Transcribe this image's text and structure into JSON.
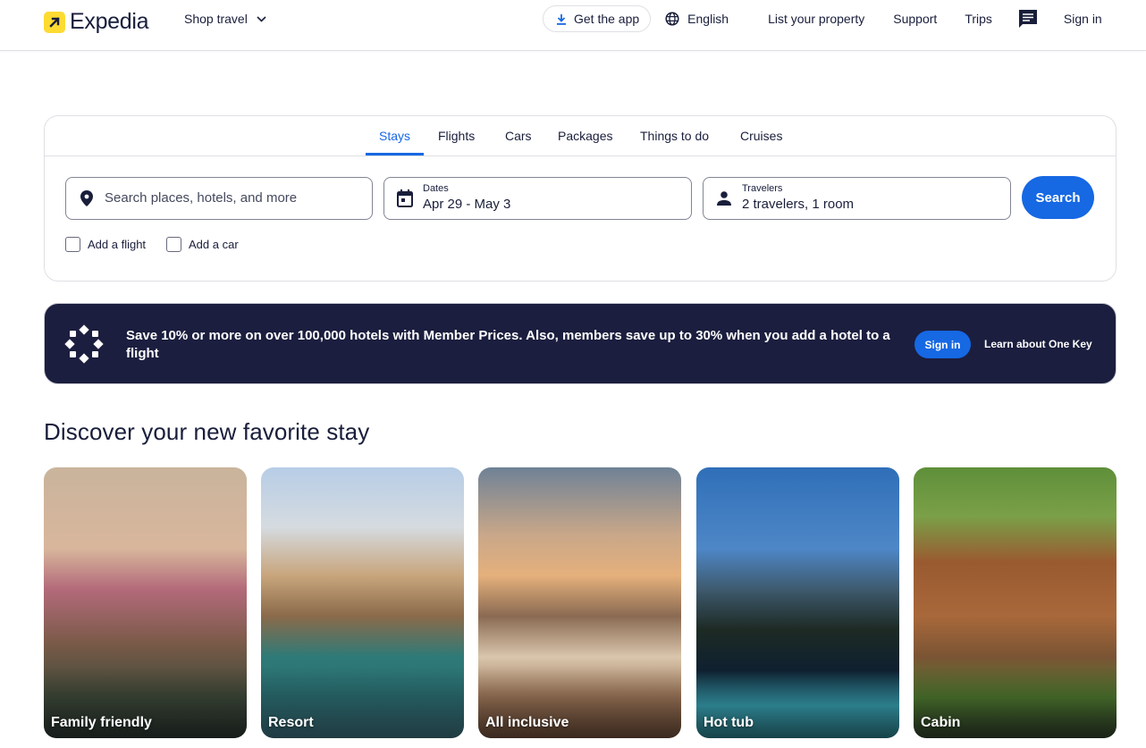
{
  "header": {
    "brand": "Expedia",
    "shop_travel": "Shop travel",
    "get_app": "Get the app",
    "language": "English",
    "list_property": "List your property",
    "support": "Support",
    "trips": "Trips",
    "sign_in": "Sign in"
  },
  "search": {
    "tabs": [
      {
        "label": "Stays",
        "active": true
      },
      {
        "label": "Flights",
        "active": false
      },
      {
        "label": "Cars",
        "active": false
      },
      {
        "label": "Packages",
        "active": false
      },
      {
        "label": "Things to do",
        "active": false
      },
      {
        "label": "Cruises",
        "active": false
      }
    ],
    "destination_placeholder": "Search places, hotels, and more",
    "dates_label": "Dates",
    "dates_value": "Apr 29 - May 3",
    "travelers_label": "Travelers",
    "travelers_value": "2 travelers, 1 room",
    "search_button": "Search",
    "add_flight": "Add a flight",
    "add_flight_checked": false,
    "add_car": "Add a car",
    "add_car_checked": false
  },
  "banner": {
    "text": "Save 10% or more on over 100,000 hotels with Member Prices. Also, members save up to 30% when you add a hotel to a flight",
    "sign_in": "Sign in",
    "learn": "Learn about One Key"
  },
  "discover": {
    "title": "Discover your new favorite stay",
    "cards": [
      {
        "label": "Family friendly"
      },
      {
        "label": "Resort"
      },
      {
        "label": "All inclusive"
      },
      {
        "label": "Hot tub"
      },
      {
        "label": "Cabin"
      }
    ]
  },
  "colors": {
    "brand_yellow": "#fddb32",
    "accent_blue": "#1668e3",
    "navy": "#191e3b",
    "banner_bg": "#1b1e3e"
  }
}
